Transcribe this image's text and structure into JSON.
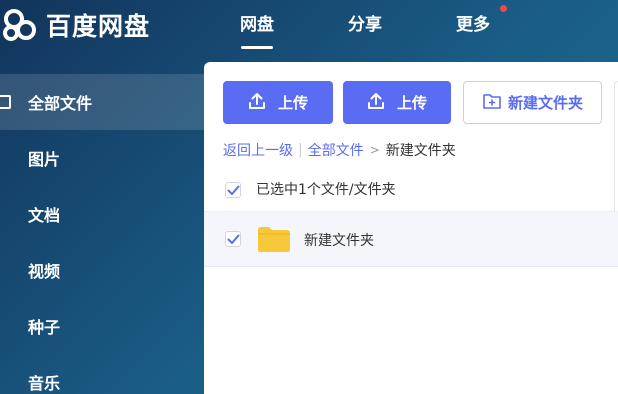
{
  "header": {
    "logo_text": "百度网盘",
    "nav": [
      {
        "label": "网盘",
        "active": true
      },
      {
        "label": "分享",
        "active": false
      },
      {
        "label": "更多",
        "active": false,
        "badge": true
      }
    ]
  },
  "sidebar": {
    "items": [
      {
        "label": "全部文件",
        "active": true
      },
      {
        "label": "图片"
      },
      {
        "label": "文档"
      },
      {
        "label": "视频"
      },
      {
        "label": "种子"
      },
      {
        "label": "音乐"
      }
    ]
  },
  "toolbar": {
    "upload_label_1": "上传",
    "upload_label_2": "上传",
    "new_folder_label": "新建文件夹"
  },
  "breadcrumb": {
    "back": "返回上一级",
    "separator": "|",
    "root": "全部文件",
    "arrow": ">",
    "current": "新建文件夹"
  },
  "selection": {
    "summary": "已选中1个文件/文件夹",
    "checked": true
  },
  "files": [
    {
      "name": "新建文件夹",
      "type": "folder",
      "checked": true
    }
  ],
  "colors": {
    "accent": "#5b6cf4",
    "folder": "#f8c83b",
    "badge": "#f2474c"
  },
  "icons": {
    "logo": "baidu-netdisk-logo",
    "upload": "upload-icon",
    "new_folder": "new-folder-icon",
    "checkbox": "check-icon",
    "folder": "folder-icon"
  }
}
